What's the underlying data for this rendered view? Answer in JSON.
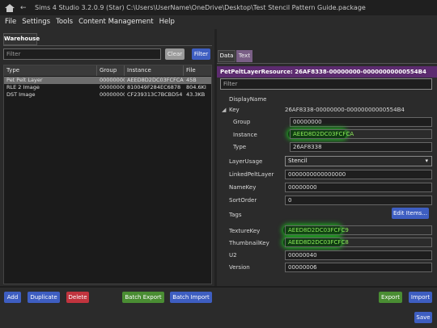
{
  "window": {
    "title": "Sims 4 Studio 3.2.0.9 (Star)   C:\\Users\\UserName\\OneDrive\\Desktop\\Test Stencil Pattern Guide.package"
  },
  "menu": [
    "File",
    "Settings",
    "Tools",
    "Content Management",
    "Help"
  ],
  "warehouse": {
    "tab_label": "Warehouse",
    "filter_placeholder": "Filter",
    "clear_label": "Clear",
    "filter_label": "Filter",
    "columns": [
      "Type",
      "Group",
      "Instance",
      "File"
    ],
    "rows": [
      {
        "type": "Pet Pelt Layer",
        "group": "00000000",
        "instance": "AEED8D2DC03FCFCA",
        "file": "45B",
        "selected": true
      },
      {
        "type": "RLE 2 Image",
        "group": "00000000",
        "instance": "810049F284EC6878",
        "file": "804.6KI",
        "selected": false
      },
      {
        "type": "DST Image",
        "group": "00000000",
        "instance": "CF239313C7BCBD54",
        "file": "43.3KB",
        "selected": false
      }
    ]
  },
  "detail": {
    "tabs": [
      "Data",
      "Text"
    ],
    "header": "PetPeltLayerResource: 26AF8338-00000000-00000000000554B4",
    "filter_placeholder": "Filter",
    "props": {
      "display_name": {
        "label": "DisplayName",
        "value": ""
      },
      "key": {
        "label": "Key",
        "value": "26AF8338-00000000-00000000000554B4"
      },
      "group": {
        "label": "Group",
        "value": "00000000"
      },
      "instance": {
        "label": "Instance",
        "value": "AEED8D2DC03FCFCA"
      },
      "type": {
        "label": "Type",
        "value": "26AF8338"
      },
      "layer_usage": {
        "label": "LayerUsage",
        "value": "Stencil"
      },
      "linked_pelt_layer": {
        "label": "LinkedPeltLayer",
        "value": "0000000000000000"
      },
      "name_key": {
        "label": "NameKey",
        "value": "00000000"
      },
      "sort_order": {
        "label": "SortOrder",
        "value": "0"
      },
      "tags": {
        "label": "Tags",
        "button": "Edit Items..."
      },
      "texture_key": {
        "label": "TextureKey",
        "value": "AEED8D2DC03FCFC9"
      },
      "thumbnail_key": {
        "label": "ThumbnailKey",
        "value": "AEED8D2DC03FCFC8"
      },
      "u2": {
        "label": "U2",
        "value": "00000040"
      },
      "version": {
        "label": "Version",
        "value": "00000006"
      }
    }
  },
  "bottom": {
    "add": "Add",
    "duplicate": "Duplicate",
    "delete": "Delete",
    "batch_export": "Batch Export",
    "batch_import": "Batch Import",
    "export": "Export",
    "import": "Import",
    "save": "Save"
  },
  "colors": {
    "accent_blue": "#3e5ec1",
    "danger_red": "#c1343e",
    "success_green": "#4a8d33",
    "header_purple": "#5c2b6f",
    "highlight_green": "#1fa322"
  }
}
